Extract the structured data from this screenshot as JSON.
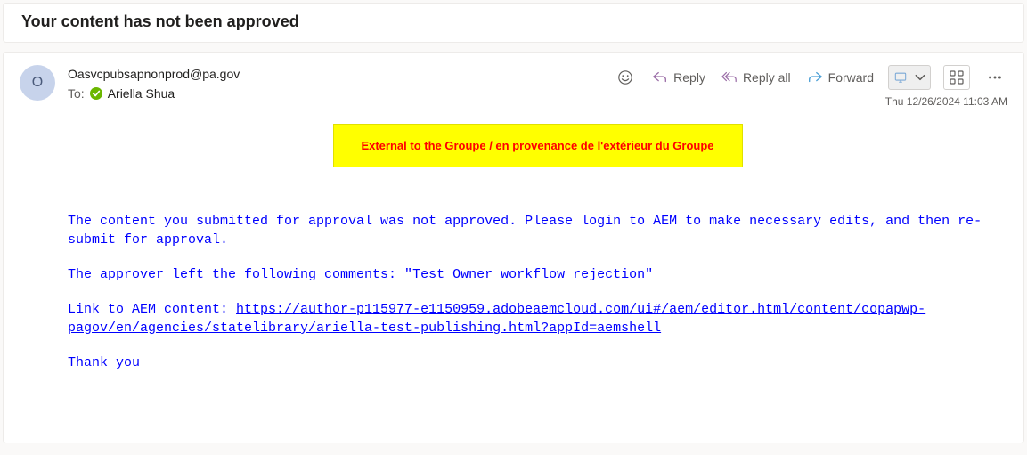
{
  "subject": "Your content has not been approved",
  "sender": {
    "email": "Oasvcpubsapnonprod@pa.gov",
    "initial": "O"
  },
  "recipient": {
    "label": "To:",
    "name": "Ariella Shua"
  },
  "timestamp": "Thu 12/26/2024 11:03 AM",
  "actions": {
    "reply": "Reply",
    "reply_all": "Reply all",
    "forward": "Forward"
  },
  "banner": "External to the Groupe / en provenance de l'extérieur du Groupe",
  "body": {
    "para1_indent": "The content you submitted for approval was not approved. Please login to AEM to make necessary edits, and then re-submit for approval.",
    "para2": "The approver left the following comments: \"Test Owner workflow rejection\"",
    "link_prefix": "Link to AEM content: ",
    "link_text": "https://author-p115977-e1150959.adobeaemcloud.com/ui#/aem/editor.html/content/copapwp-pagov/en/agencies/statelibrary/ariella-test-publishing.html?appId=aemshell",
    "thanks": "Thank you"
  }
}
